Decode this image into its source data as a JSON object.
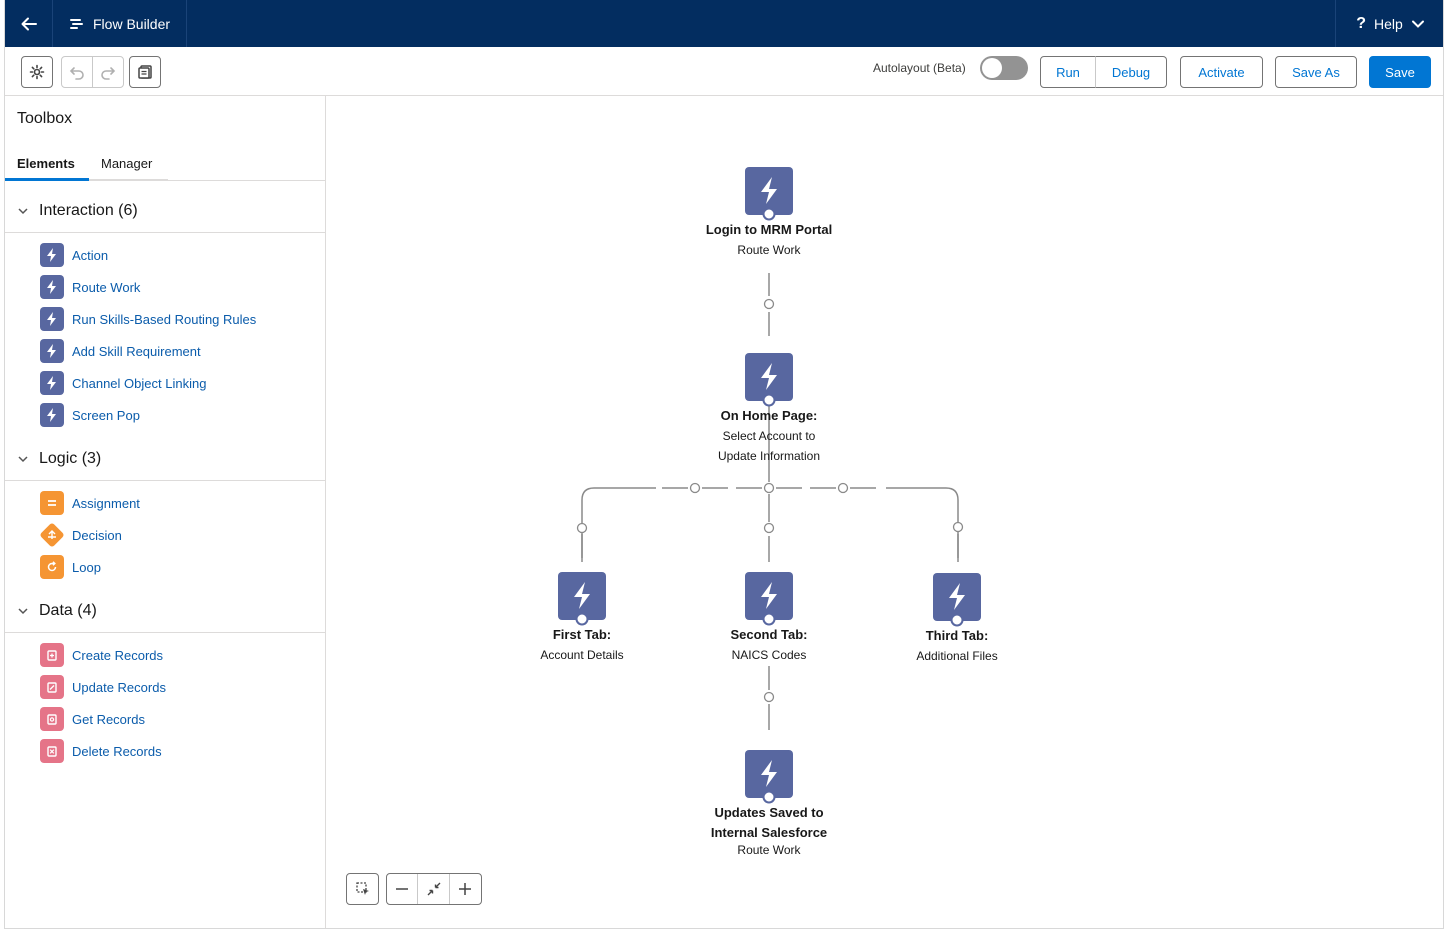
{
  "topbar": {
    "app_title": "Flow Builder",
    "help_label": "Help"
  },
  "toolbar": {
    "autolayout_label": "Autolayout (Beta)",
    "run_label": "Run",
    "debug_label": "Debug",
    "activate_label": "Activate",
    "save_as_label": "Save As",
    "save_label": "Save"
  },
  "toolbox": {
    "title": "Toolbox",
    "tabs": [
      {
        "label": "Elements"
      },
      {
        "label": "Manager"
      }
    ],
    "sections": [
      {
        "label": "Interaction (6)",
        "items": [
          "Action",
          "Route Work",
          "Run Skills-Based Routing Rules",
          "Add Skill Requirement",
          "Channel Object Linking",
          "Screen Pop"
        ]
      },
      {
        "label": "Logic (3)",
        "items": [
          "Assignment",
          "Decision",
          "Loop"
        ]
      },
      {
        "label": "Data (4)",
        "items": [
          "Create Records",
          "Update Records",
          "Get Records",
          "Delete Records"
        ]
      }
    ]
  },
  "flow": {
    "nodes": [
      {
        "title": "Login to MRM Portal",
        "sub1": "Route Work",
        "sub2": ""
      },
      {
        "title": "On Home Page:",
        "sub1": "Select Account to",
        "sub2": "Update Information"
      },
      {
        "title": "First Tab:",
        "sub1": "Account Details",
        "sub2": ""
      },
      {
        "title": "Second Tab:",
        "sub1": "NAICS Codes",
        "sub2": ""
      },
      {
        "title": "Third Tab:",
        "sub1": "Additional Files",
        "sub2": ""
      },
      {
        "title": "Updates Saved to",
        "title2": "Internal Salesforce",
        "sub1": "Route Work"
      }
    ]
  },
  "colors": {
    "navy": "#032d60",
    "brand": "#0176d3",
    "node": "#5867a0",
    "logic": "#f59533",
    "data": "#e57488"
  }
}
